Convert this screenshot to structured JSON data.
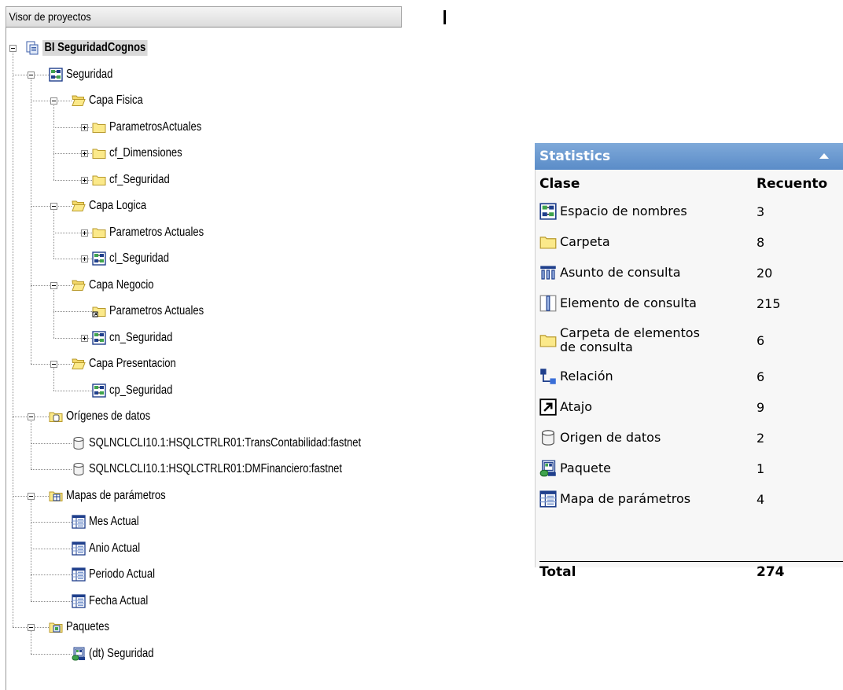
{
  "project_viewer": {
    "title": "Visor de proyectos",
    "tree": [
      {
        "label": "BI SeguridadCognos",
        "icon": "project-icon",
        "level": 0,
        "root": true
      },
      {
        "label": "Seguridad",
        "icon": "namespace-icon",
        "level": 1
      },
      {
        "label": "Capa Fisica",
        "icon": "folder-open-icon",
        "level": 2
      },
      {
        "label": "ParametrosActuales",
        "icon": "folder-icon",
        "level": 3
      },
      {
        "label": "cf_Dimensiones",
        "icon": "folder-icon",
        "level": 3
      },
      {
        "label": "cf_Seguridad",
        "icon": "folder-icon",
        "level": 3
      },
      {
        "label": "Capa Logica",
        "icon": "folder-open-icon",
        "level": 2
      },
      {
        "label": "Parametros Actuales",
        "icon": "folder-icon",
        "level": 3
      },
      {
        "label": "cl_Seguridad",
        "icon": "namespace-icon",
        "level": 3
      },
      {
        "label": "Capa Negocio",
        "icon": "folder-open-icon",
        "level": 2
      },
      {
        "label": "Parametros Actuales",
        "icon": "folder-shortcut-icon",
        "level": 3
      },
      {
        "label": "cn_Seguridad",
        "icon": "namespace-icon",
        "level": 3
      },
      {
        "label": "Capa Presentacion",
        "icon": "folder-open-icon",
        "level": 2
      },
      {
        "label": "cp_Seguridad",
        "icon": "namespace-icon",
        "level": 3
      },
      {
        "label": "Orígenes de datos",
        "icon": "data-sources-folder-icon",
        "level": 1
      },
      {
        "label": "SQLNCLCLI10.1:HSQLCTRLR01:TransContabilidad:fastnet",
        "icon": "data-source-icon",
        "level": 2
      },
      {
        "label": "SQLNCLCLI10.1:HSQLCTRLR01:DMFinanciero:fastnet",
        "icon": "data-source-icon",
        "level": 2
      },
      {
        "label": "Mapas de parámetros",
        "icon": "parameter-maps-folder-icon",
        "level": 1
      },
      {
        "label": "Mes Actual",
        "icon": "parameter-map-icon",
        "level": 2
      },
      {
        "label": "Anio Actual",
        "icon": "parameter-map-icon",
        "level": 2
      },
      {
        "label": "Periodo Actual",
        "icon": "parameter-map-icon",
        "level": 2
      },
      {
        "label": "Fecha Actual",
        "icon": "parameter-map-icon",
        "level": 2
      },
      {
        "label": "Paquetes",
        "icon": "packages-folder-icon",
        "level": 1
      },
      {
        "label": "(dt) Seguridad",
        "icon": "package-icon",
        "level": 2
      }
    ]
  },
  "statistics": {
    "title": "Statistics",
    "col_class": "Clase",
    "col_count": "Recuento",
    "rows": [
      {
        "icon": "namespace-icon",
        "name": "Espacio de nombres",
        "count": "3"
      },
      {
        "icon": "folder-icon",
        "name": "Carpeta",
        "count": "8"
      },
      {
        "icon": "query-subject-icon",
        "name": "Asunto de consulta",
        "count": "20"
      },
      {
        "icon": "query-item-icon",
        "name": "Elemento de consulta",
        "count": "215"
      },
      {
        "icon": "query-item-folder-icon",
        "name": "Carpeta de elementos de consulta",
        "count": "6"
      },
      {
        "icon": "relationship-icon",
        "name": "Relación",
        "count": "6"
      },
      {
        "icon": "shortcut-icon",
        "name": "Atajo",
        "count": "9"
      },
      {
        "icon": "data-source-icon",
        "name": "Origen de datos",
        "count": "2"
      },
      {
        "icon": "package-icon",
        "name": "Paquete",
        "count": "1"
      },
      {
        "icon": "parameter-map-icon",
        "name": "Mapa de parámetros",
        "count": "4"
      }
    ],
    "total_label": "Total",
    "total_count": "274"
  }
}
